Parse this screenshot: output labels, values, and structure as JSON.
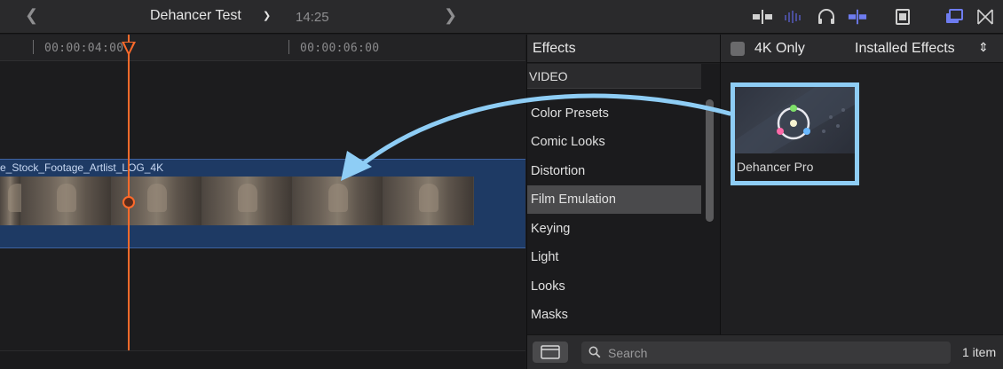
{
  "toolbar": {
    "project_name": "Dehancer Test",
    "duration": "14:25"
  },
  "timeline": {
    "timecodes": [
      "00:00:04:00",
      "00:00:06:00"
    ],
    "clip_name": "e_Stock_Footage_Artlist_LOG_4K",
    "playhead_color": "#ff6a2b"
  },
  "effects": {
    "title": "Effects",
    "four_k_only": "4K Only",
    "filter": "Installed Effects",
    "section": "VIDEO",
    "categories": [
      {
        "label": "Color Presets",
        "selected": false
      },
      {
        "label": "Comic Looks",
        "selected": false
      },
      {
        "label": "Distortion",
        "selected": false
      },
      {
        "label": "Film Emulation",
        "selected": true
      },
      {
        "label": "Keying",
        "selected": false
      },
      {
        "label": "Light",
        "selected": false
      },
      {
        "label": "Looks",
        "selected": false
      },
      {
        "label": "Masks",
        "selected": false
      }
    ],
    "items": [
      {
        "name": "Dehancer Pro",
        "highlight_color": "#8ecdf5"
      }
    ],
    "search_placeholder": "Search",
    "item_count": "1 item"
  },
  "colors": {
    "accent_highlight": "#8ecdf5",
    "clip_blue": "#1e3a64"
  }
}
